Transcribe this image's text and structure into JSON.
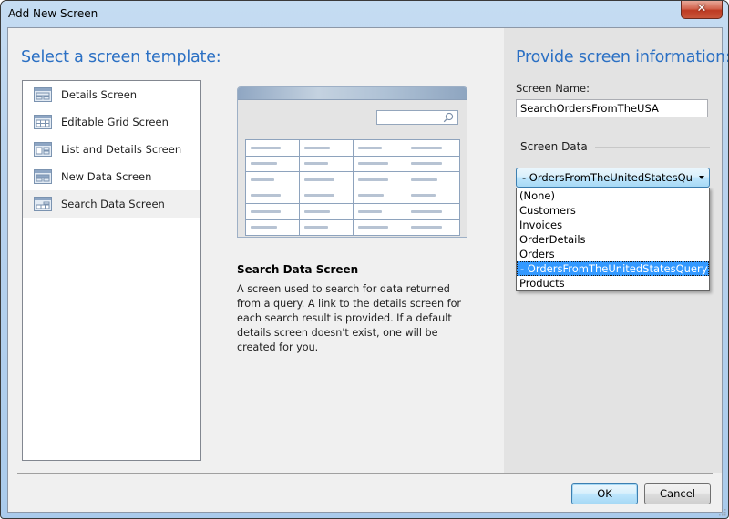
{
  "window": {
    "title": "Add New Screen",
    "close_glyph": "✕"
  },
  "left": {
    "heading": "Select a screen template:",
    "templates": [
      {
        "label": "Details Screen",
        "icon": "details-screen-icon",
        "selected": false
      },
      {
        "label": "Editable Grid Screen",
        "icon": "editable-grid-screen-icon",
        "selected": false
      },
      {
        "label": "List and Details Screen",
        "icon": "list-details-screen-icon",
        "selected": false
      },
      {
        "label": "New Data Screen",
        "icon": "new-data-screen-icon",
        "selected": false
      },
      {
        "label": "Search Data Screen",
        "icon": "search-data-screen-icon",
        "selected": true
      }
    ]
  },
  "preview": {
    "title": "Search Data Screen",
    "description": "A screen used to search for data returned from a query.  A link to the details screen for each search result is provided.  If a default details screen doesn't exist, one will be created for you.",
    "grid_rows": 6,
    "grid_cols": 4
  },
  "right": {
    "heading": "Provide screen information:",
    "screen_name_label": "Screen Name:",
    "screen_name_value": "SearchOrdersFromTheUSA",
    "screen_data_label": "Screen Data",
    "screen_data_selected": "- OrdersFromTheUnitedStatesQuery",
    "screen_data_options": [
      "(None)",
      "Customers",
      "Invoices",
      "OrderDetails",
      "Orders",
      "- OrdersFromTheUnitedStatesQuery",
      "Products"
    ],
    "selected_index": 5
  },
  "footer": {
    "ok_label": "OK",
    "cancel_label": "Cancel"
  },
  "colors": {
    "heading_blue": "#2b70c4",
    "selection_blue": "#3399ff"
  }
}
